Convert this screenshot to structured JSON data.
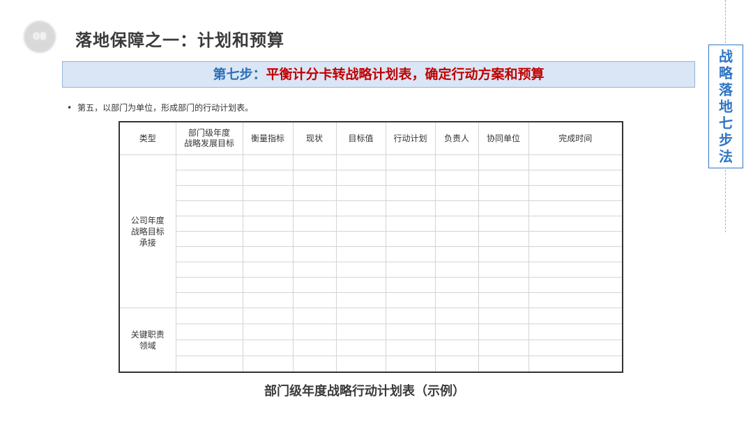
{
  "badge": "08",
  "title": "落地保障之一：计划和预算",
  "step": {
    "label": "第七步：",
    "text": "平衡计分卡转战略计划表，确定行动方案和预算"
  },
  "side_title": [
    "战",
    "略",
    "落",
    "地",
    "七",
    "步",
    "法"
  ],
  "bullet": {
    "symbol": "•",
    "text": "第五，以部门为单位，形成部门的行动计划表。"
  },
  "table": {
    "headers": [
      "类型",
      "部门级年度\n战略发展目标",
      "衡量指标",
      "现状",
      "目标值",
      "行动计划",
      "负责人",
      "协同单位",
      "完成时间"
    ],
    "groups": [
      {
        "label": "公司年度\n战略目标\n承接",
        "rows": 10
      },
      {
        "label": "关键职责\n领域",
        "rows": 4
      }
    ]
  },
  "caption": "部门级年度战略行动计划表（示例）"
}
